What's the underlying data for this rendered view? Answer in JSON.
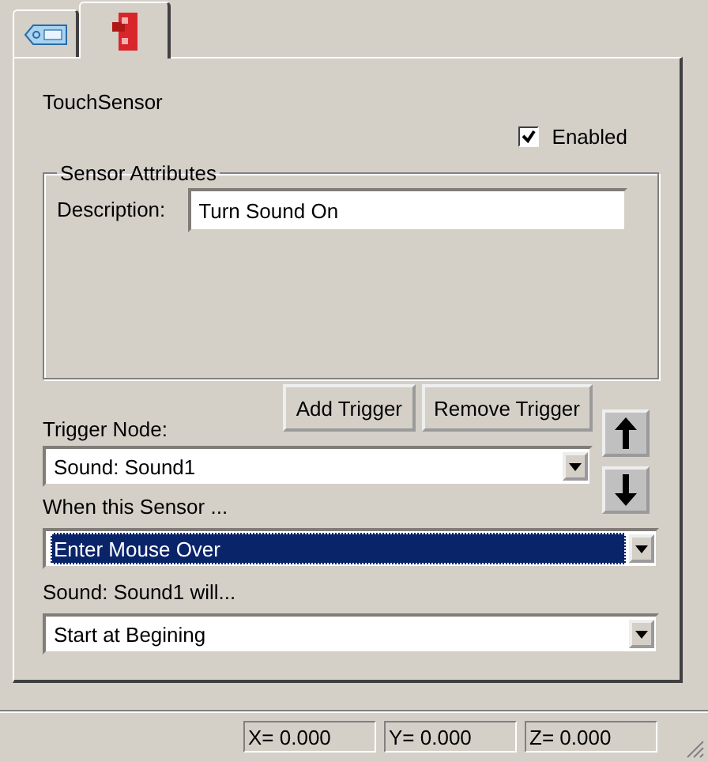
{
  "tabs": [
    {
      "kind": "tag",
      "selected": false
    },
    {
      "kind": "sensor",
      "selected": true
    }
  ],
  "node_title": "TouchSensor",
  "enabled": {
    "label": "Enabled",
    "checked": true
  },
  "group": {
    "title": "Sensor Attributes",
    "description_label": "Description:",
    "description_value": "Turn Sound On"
  },
  "buttons": [
    "Add Trigger",
    "Remove Trigger"
  ],
  "trigger_label": "Trigger Node:",
  "move_buttons": [
    {
      "kind": "up"
    },
    {
      "kind": "down"
    }
  ],
  "trigger_combo": {
    "value": "Sound:  Sound1",
    "highlighted": false
  },
  "when_label": "When this Sensor ...",
  "when_combo": {
    "value": "Enter Mouse Over",
    "highlighted": true
  },
  "action_label": "Sound:  Sound1 will...",
  "action_combo": {
    "value": "Start at Begining",
    "highlighted": false
  },
  "status_bar": [
    "X=  0.000",
    "Y=  0.000",
    "Z=  0.000"
  ]
}
